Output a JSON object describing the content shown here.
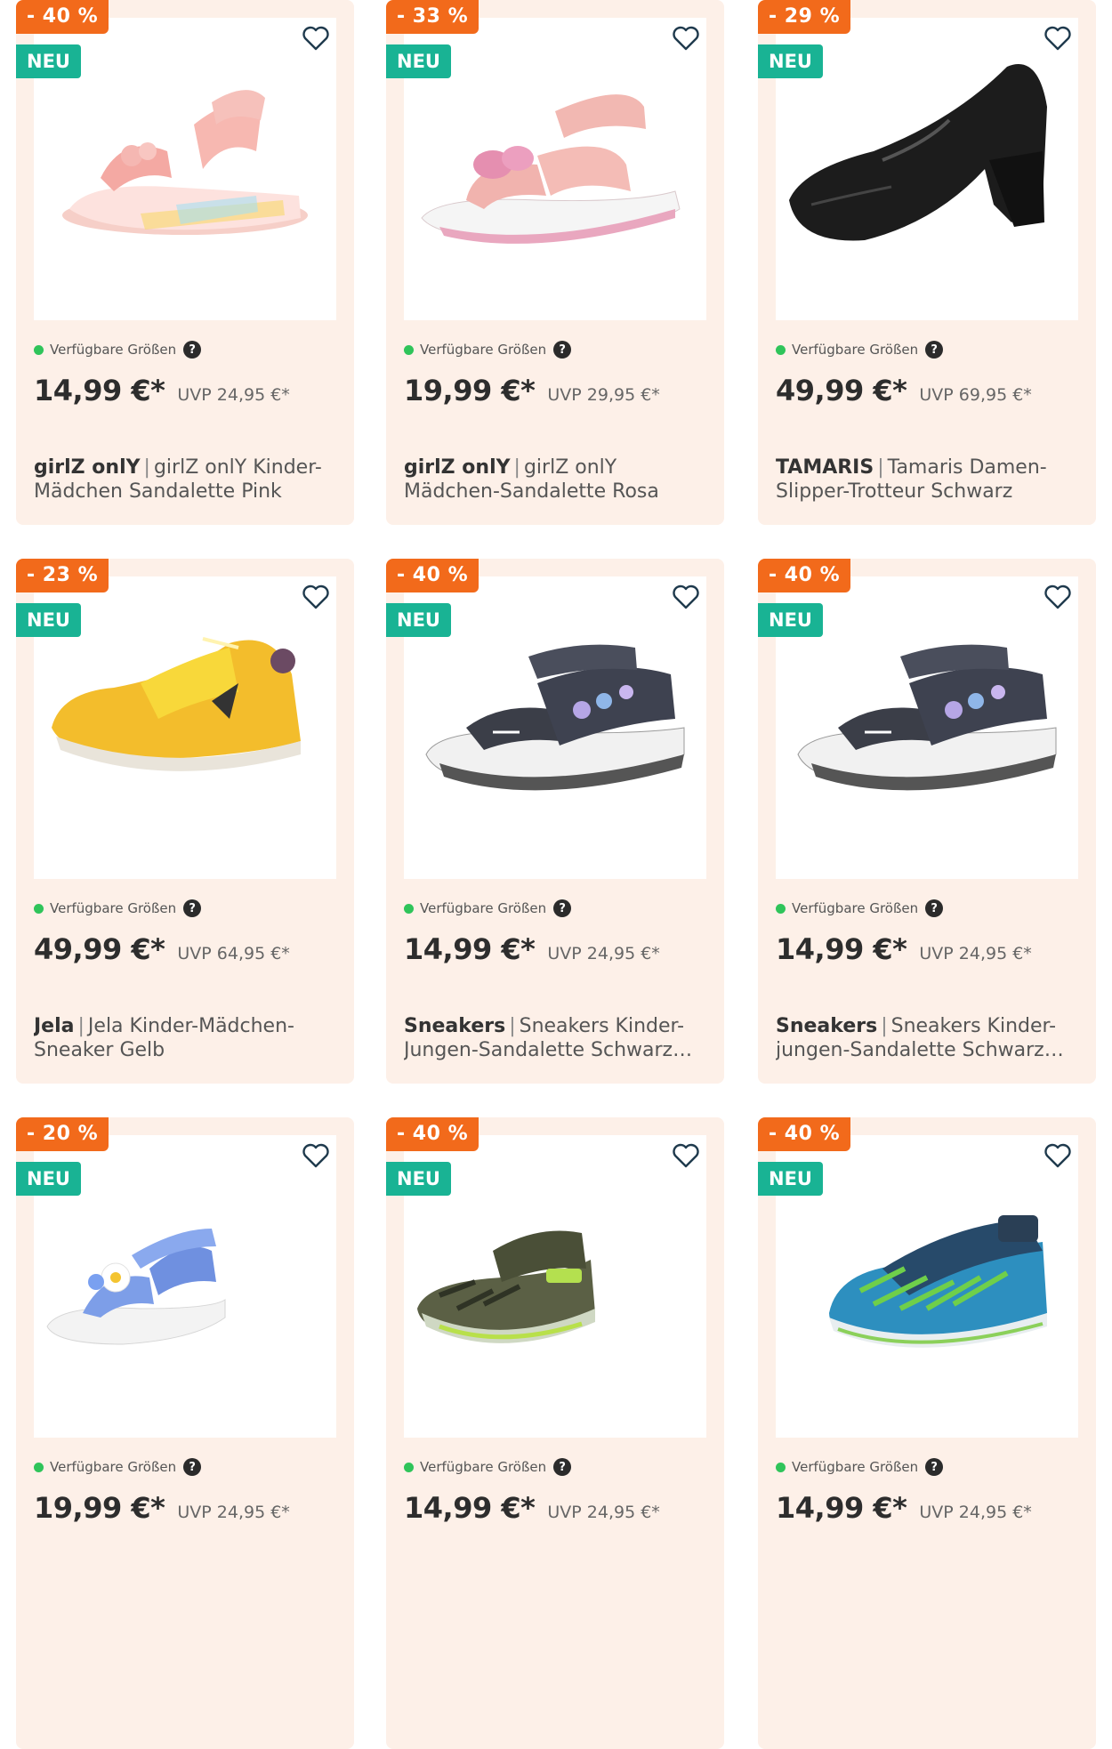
{
  "products": [
    {
      "discount": "- 40 %",
      "badge": "NEU",
      "sizes_label": "Verfügbare Größen",
      "price": "14,99 €*",
      "uvp": "UVP 24,95 €*",
      "brand": "girlZ onlY",
      "name": "girlZ onlY Kinder-Mädchen Sandalette Pink",
      "image": "pink-rainbow-sandal"
    },
    {
      "discount": "- 33 %",
      "badge": "NEU",
      "sizes_label": "Verfügbare Größen",
      "price": "19,99 €*",
      "uvp": "UVP 29,95 €*",
      "brand": "girlZ onlY",
      "name": "girlZ onlY Mädchen-Sandalette Rosa",
      "image": "rose-butterfly-sandal"
    },
    {
      "discount": "- 29 %",
      "badge": "NEU",
      "sizes_label": "Verfügbare Größen",
      "price": "49,99 €*",
      "uvp": "UVP 69,95 €*",
      "brand": "TAMARIS",
      "name": "Tamaris Damen-Slipper-Trotteur Schwarz",
      "image": "black-heel-loafer"
    },
    {
      "discount": "- 23 %",
      "badge": "NEU",
      "sizes_label": "Verfügbare Größen",
      "price": "49,99 €*",
      "uvp": "UVP 64,95 €*",
      "brand": "Jela",
      "name": "Jela Kinder-Mädchen-Sneaker Gelb",
      "image": "yellow-sneaker"
    },
    {
      "discount": "- 40 %",
      "badge": "NEU",
      "sizes_label": "Verfügbare Größen",
      "price": "14,99 €*",
      "uvp": "UVP 24,95 €*",
      "brand": "Sneakers",
      "name": "Sneakers Kinder-Jungen-Sandalette Schwarz-Blau",
      "image": "black-floral-sandal"
    },
    {
      "discount": "- 40 %",
      "badge": "NEU",
      "sizes_label": "Verfügbare Größen",
      "price": "14,99 €*",
      "uvp": "UVP 24,95 €*",
      "brand": "Sneakers",
      "name": "Sneakers Kinder-jungen-Sandalette Schwarz-Blau",
      "image": "black-floral-sandal"
    },
    {
      "discount": "- 20 %",
      "badge": "NEU",
      "sizes_label": "Verfügbare Größen",
      "price": "19,99 €*",
      "uvp": "UVP 24,95 €*",
      "brand": "",
      "name": "",
      "image": "blue-daisy-sandal"
    },
    {
      "discount": "- 40 %",
      "badge": "NEU",
      "sizes_label": "Verfügbare Größen",
      "price": "14,99 €*",
      "uvp": "UVP 24,95 €*",
      "brand": "",
      "name": "",
      "image": "olive-closed-sandal"
    },
    {
      "discount": "- 40 %",
      "badge": "NEU",
      "sizes_label": "Verfügbare Größen",
      "price": "14,99 €*",
      "uvp": "UVP 24,95 €*",
      "brand": "",
      "name": "",
      "image": "blue-green-closed-sandal"
    }
  ],
  "colors": {
    "card_bg": "#fdf0e8",
    "discount": "#f26a1b",
    "neu": "#19b394",
    "available": "#2fc45a",
    "heart": "#1f3a4d"
  }
}
